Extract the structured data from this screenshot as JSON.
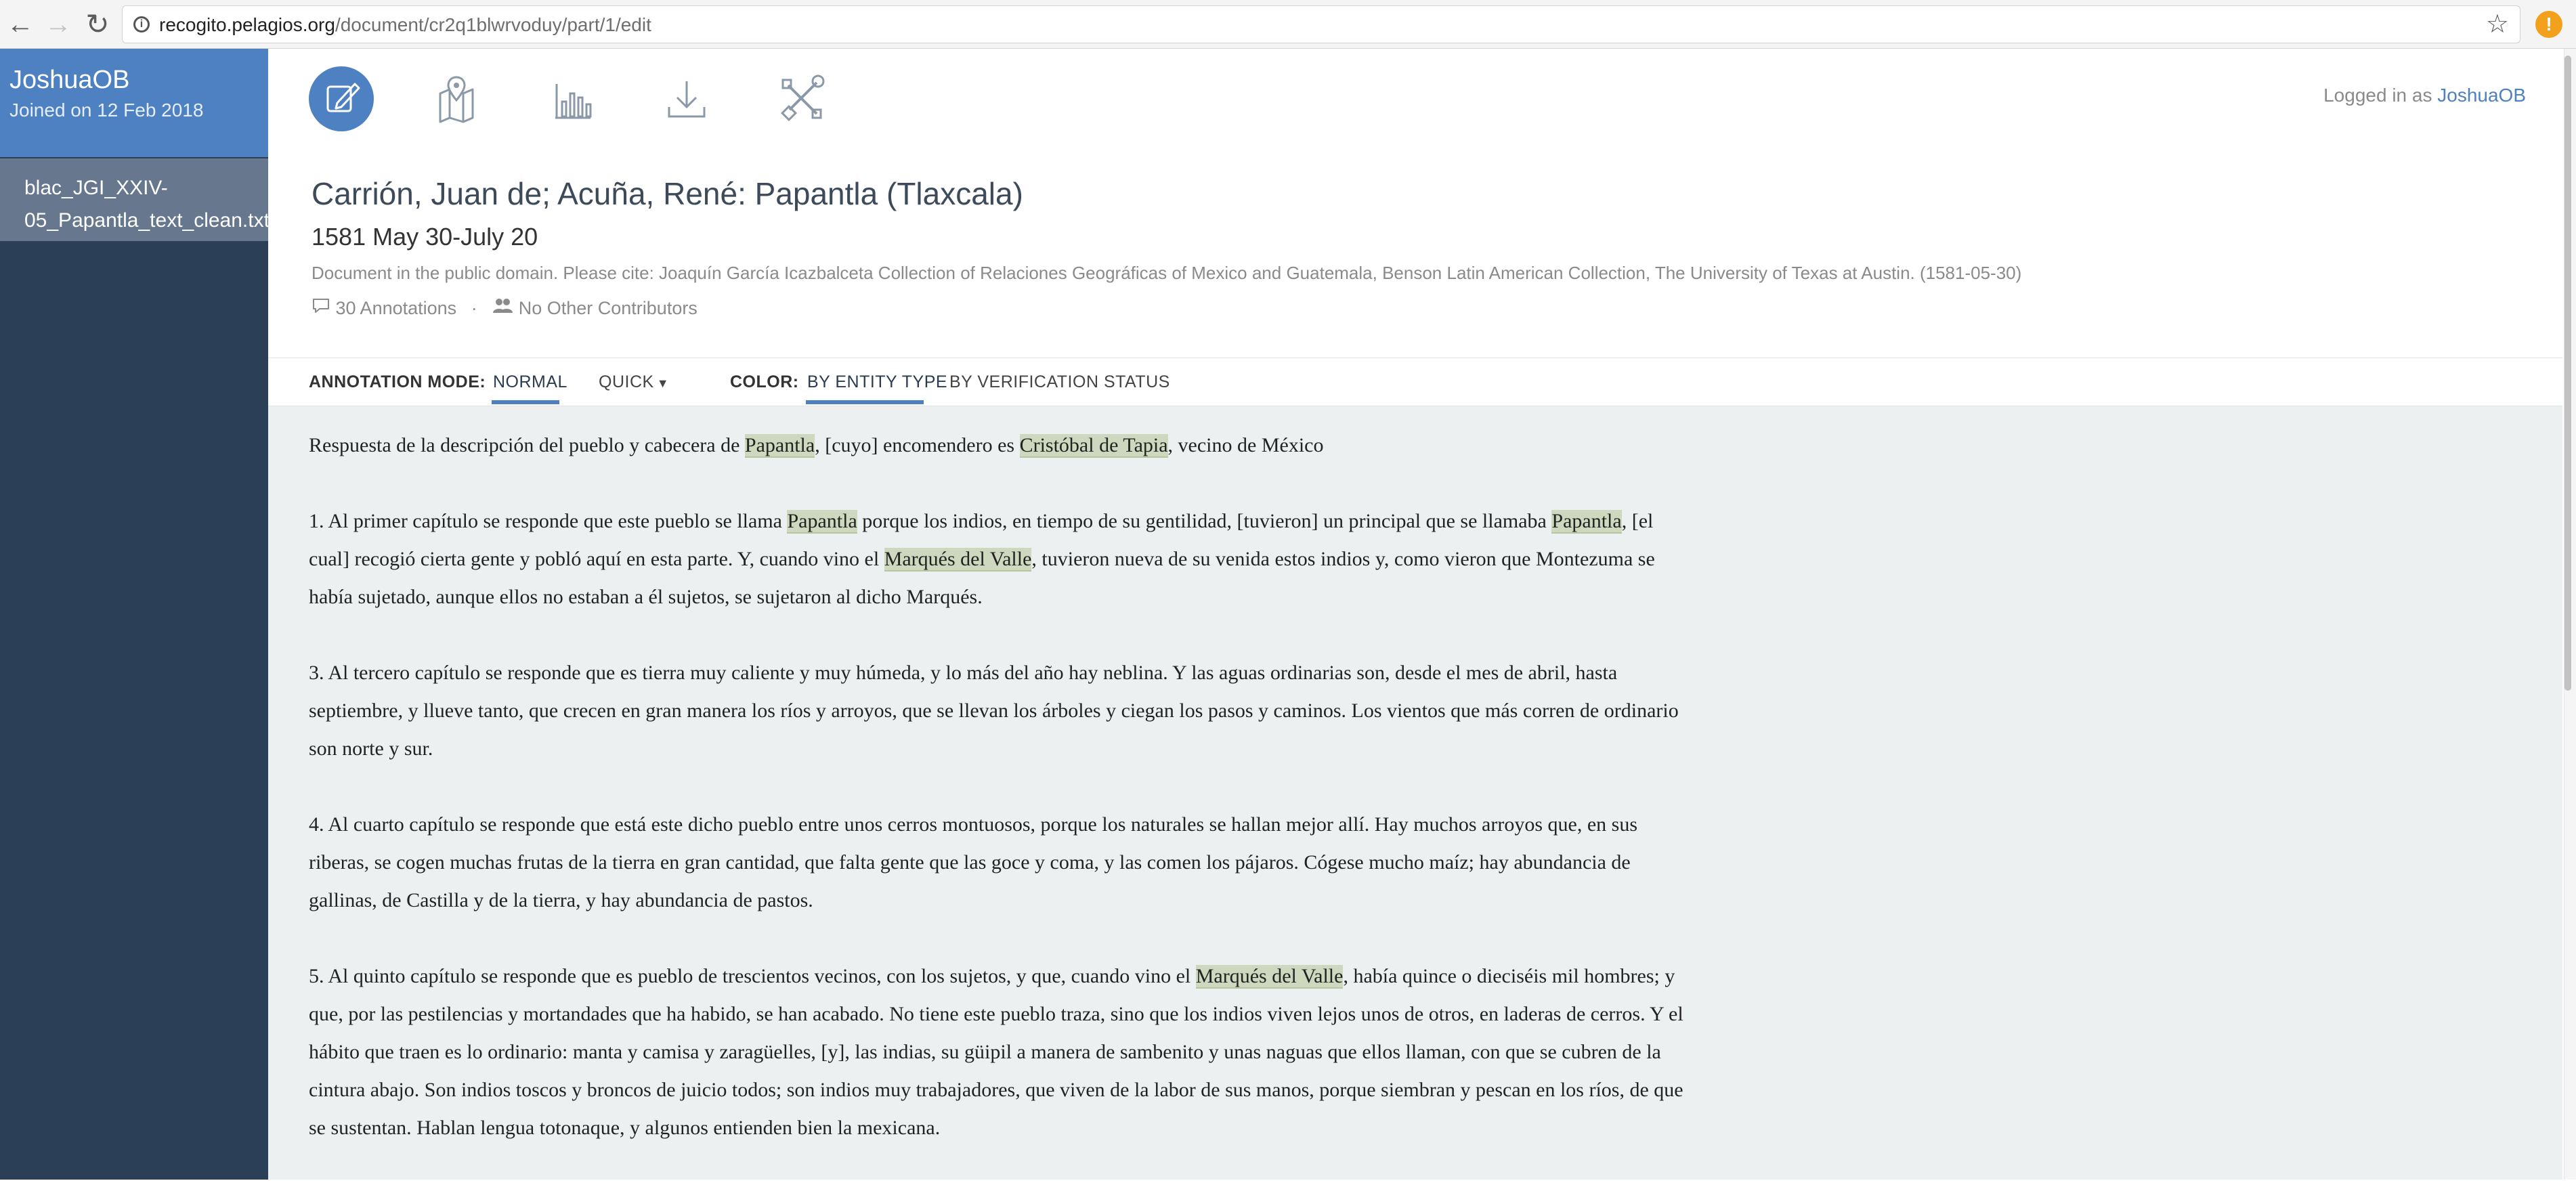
{
  "browser": {
    "url_host": "recogito.pelagios.org",
    "url_path": "/document/cr2q1blwrvoduy/part/1/edit",
    "back_icon": "arrow-left",
    "forward_icon": "arrow-right",
    "reload_icon": "reload",
    "bookmark_icon": "star",
    "extension_badge": "!"
  },
  "sidebar": {
    "user_name": "JoshuaOB",
    "joined": "Joined on 12 Feb 2018",
    "document_item": "blac_JGI_XXIV-05_Papantla_text_clean.txt"
  },
  "toolbar": {
    "icons": [
      "edit-icon",
      "map-icon",
      "stats-icon",
      "download-icon",
      "settings-icon"
    ],
    "logged_in_prefix": "Logged in as",
    "logged_in_user": "JoshuaOB"
  },
  "document": {
    "title": "Carrión, Juan de; Acuña, René: Papantla (Tlaxcala)",
    "date": "1581 May 30-July 20",
    "citation": "Document in the public domain. Please cite: Joaquín García Icazbalceta Collection of Relaciones Geográficas of Mexico and Guatemala, Benson Latin American Collection, The University of Texas at Austin. (1581-05-30)",
    "annotations": "30 Annotations",
    "separator": "·",
    "contributors": "No Other Contributors"
  },
  "modebar": {
    "annotation_mode_label": "ANNOTATION MODE:",
    "normal": "NORMAL",
    "quick": "QUICK",
    "color_label": "COLOR:",
    "by_entity_type": "BY ENTITY TYPE",
    "by_verification_status": "BY VERIFICATION STATUS"
  },
  "text": {
    "p0": {
      "a": "Respuesta de la descripción del pueblo y cabecera de ",
      "h1": "Papantla",
      "b": ", [cuyo] encomendero es ",
      "h2": "Cristóbal de Tapia",
      "c": ", vecino de México"
    },
    "p1": {
      "a": "1. Al primer capítulo se responde que este pueblo se llama ",
      "h1": "Papantla",
      "b": " porque los indios, en tiempo de su gentilidad, [tuvieron] un principal que se llamaba ",
      "h2": "Papantla",
      "c": ", [el cual] recogió cierta gente y pobló aquí en esta parte. Y, cuando vino el ",
      "h3": "Marqués del Valle",
      "d": ", tuvieron nueva de su venida estos indios y, como vieron que Montezuma se había sujetado, aunque ellos no estaban a él sujetos, se sujetaron al dicho Marqués."
    },
    "p3": "3. Al tercero capítulo se responde que es tierra muy caliente y muy húmeda, y lo más del año hay neblina. Y las aguas ordinarias son, desde el mes de abril, hasta septiembre, y llueve tanto, que crecen en gran manera los ríos y arroyos, que se llevan los árboles y ciegan los pasos y caminos. Los vientos que más corren de ordinario son norte y sur.",
    "p4": "4. Al cuarto capítulo se responde que está este dicho pueblo entre unos cerros montuosos, porque los naturales se hallan mejor allí. Hay muchos arroyos que, en sus riberas, se cogen muchas frutas de la tierra en gran cantidad, que falta gente que las goce y coma, y las comen los pájaros. Cógese mucho maíz; hay abundancia de gallinas, de Castilla y de la tierra, y hay abundancia de pastos.",
    "p5": {
      "a": "5. Al quinto capítulo se responde que es pueblo de trescientos vecinos, con los sujetos, y que, cuando vino el ",
      "h1": "Marqués del Valle",
      "b": ", había quince o dieciséis mil hombres; y que, por las pestilencias y mortandades que ha habido, se han acabado. No tiene este pueblo traza, sino que los indios viven lejos unos de otros, en laderas de cerros. Y el hábito que traen es lo ordinario: manta y camisa y zaragüelles, [y], las indias, su güipil a manera de sambenito y unas naguas que ellos llaman, con que se cubren de la cintura abajo. Son indios toscos y broncos de juicio todos; son indios muy trabajadores, que viven de la labor de sus manos, porque siembran y pescan en los ríos, de que se sustentan. Hablan lengua totonaque, y algunos entienden bien la mexicana."
    }
  },
  "colors": {
    "accent": "#4e81c2",
    "sidebar": "#2b3f57",
    "highlight": "#cdd8be",
    "content_bg": "#ecf0f1"
  }
}
